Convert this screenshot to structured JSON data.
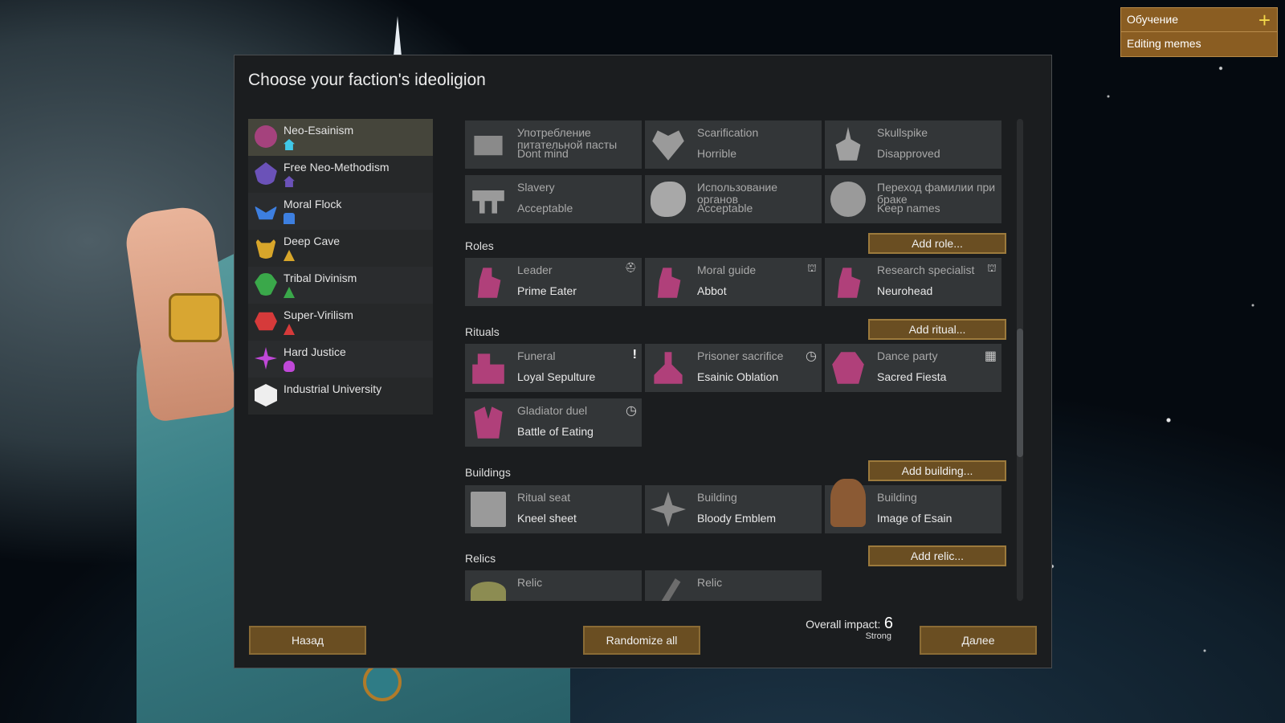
{
  "tutor": {
    "items": [
      "Обучение",
      "Editing memes"
    ],
    "plus_icon": "plus-icon"
  },
  "dialog": {
    "title": "Choose your faction's ideoligion",
    "factions": [
      {
        "name": "Neo-Esainism",
        "color": "#a5427d",
        "mark_color": "#40c8e8",
        "selected": true
      },
      {
        "name": "Free Neo-Methodism",
        "color": "#6b52b8",
        "mark_color": "#6b52b8"
      },
      {
        "name": "Moral Flock",
        "color": "#3d7fe0",
        "mark_color": "#3d7fe0"
      },
      {
        "name": "Deep Cave",
        "color": "#d8a62a",
        "mark_color": "#d8a62a"
      },
      {
        "name": "Tribal Divinism",
        "color": "#3aa84a",
        "mark_color": "#3aa84a"
      },
      {
        "name": "Super-Virilism",
        "color": "#d63a3a",
        "mark_color": "#d63a3a"
      },
      {
        "name": "Hard Justice",
        "color": "#c048d8",
        "mark_color": "#c048d8"
      },
      {
        "name": "Industrial University",
        "color": "#eeeeee",
        "mark_color": ""
      }
    ],
    "precepts": [
      {
        "title": "Употребление питательной пасты",
        "value": "Dont mind",
        "icon": "nutrient-paste-icon"
      },
      {
        "title": "Scarification",
        "value": "Horrible",
        "icon": "scarred-heart-icon"
      },
      {
        "title": "Skullspike",
        "value": "Disapproved",
        "icon": "skullspike-icon"
      },
      {
        "title": "Slavery",
        "value": "Acceptable",
        "icon": "shackles-icon"
      },
      {
        "title": "Использование органов",
        "value": "Acceptable",
        "icon": "organs-icon"
      },
      {
        "title": "Переход фамилии при браке",
        "value": "Keep names",
        "icon": "rings-icon"
      }
    ],
    "roles": {
      "heading": "Roles",
      "add": "Add role...",
      "items": [
        {
          "title": "Leader",
          "value": "Prime Eater"
        },
        {
          "title": "Moral guide",
          "value": "Abbot"
        },
        {
          "title": "Research specialist",
          "value": "Neurohead"
        }
      ]
    },
    "rituals": {
      "heading": "Rituals",
      "add": "Add ritual...",
      "items": [
        {
          "title": "Funeral",
          "value": "Loyal Sepulture",
          "corner": "!"
        },
        {
          "title": "Prisoner sacrifice",
          "value": "Esainic Oblation",
          "corner": "◷"
        },
        {
          "title": "Dance party",
          "value": "Sacred Fiesta",
          "corner": "▦"
        },
        {
          "title": "Gladiator duel",
          "value": "Battle of Eating",
          "corner": "◷"
        }
      ]
    },
    "buildings": {
      "heading": "Buildings",
      "add": "Add building...",
      "items": [
        {
          "title": "Ritual seat",
          "value": "Kneel sheet"
        },
        {
          "title": "Building",
          "value": "Bloody Emblem"
        },
        {
          "title": "Building",
          "value": "Image of Esain"
        }
      ]
    },
    "relics": {
      "heading": "Relics",
      "add": "Add relic...",
      "items": [
        {
          "title": "Relic"
        },
        {
          "title": "Relic"
        }
      ]
    },
    "footer": {
      "back": "Назад",
      "randomize": "Randomize all",
      "impact_label": "Overall impact:",
      "impact_value": "6",
      "impact_desc": "Strong",
      "next": "Далее"
    },
    "colors": {
      "accent_button": "#6a4e22",
      "panel": "#1b1d1f",
      "card": "#333638",
      "ritual_pink": "#b0407a"
    }
  }
}
